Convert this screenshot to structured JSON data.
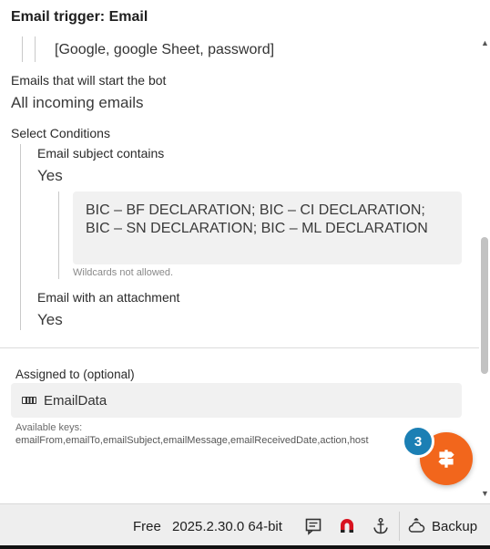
{
  "header": {
    "title": "Email trigger: Email"
  },
  "keywords_line": "[Google, google Sheet, password]",
  "emails_start": {
    "label": "Emails that will start the bot",
    "value": "All incoming emails"
  },
  "conditions": {
    "label": "Select Conditions",
    "subject": {
      "label": "Email subject contains",
      "value": "Yes",
      "pattern_line1": "BIC – BF DECLARATION; BIC – CI DECLARATION;",
      "pattern_line2": "BIC – SN DECLARATION; BIC – ML DECLARATION",
      "hint": "Wildcards not allowed."
    },
    "attachment": {
      "label": "Email with an attachment",
      "value": "Yes"
    }
  },
  "assigned": {
    "label": "Assigned to (optional)",
    "variable": "EmailData",
    "keys_label": "Available keys:",
    "keys": "emailFrom,emailTo,emailSubject,emailMessage,emailReceivedDate,action,host"
  },
  "fab": {
    "badge": "3",
    "icon": "signpost-icon"
  },
  "statusbar": {
    "plan": "Free",
    "version": "2025.2.30.0 64-bit",
    "backup_label": "Backup",
    "icons": [
      "notes-icon",
      "magnet-icon",
      "anchor-icon",
      "backup-icon"
    ]
  },
  "colors": {
    "accent": "#f2661c",
    "badge": "#1b7fb4"
  }
}
